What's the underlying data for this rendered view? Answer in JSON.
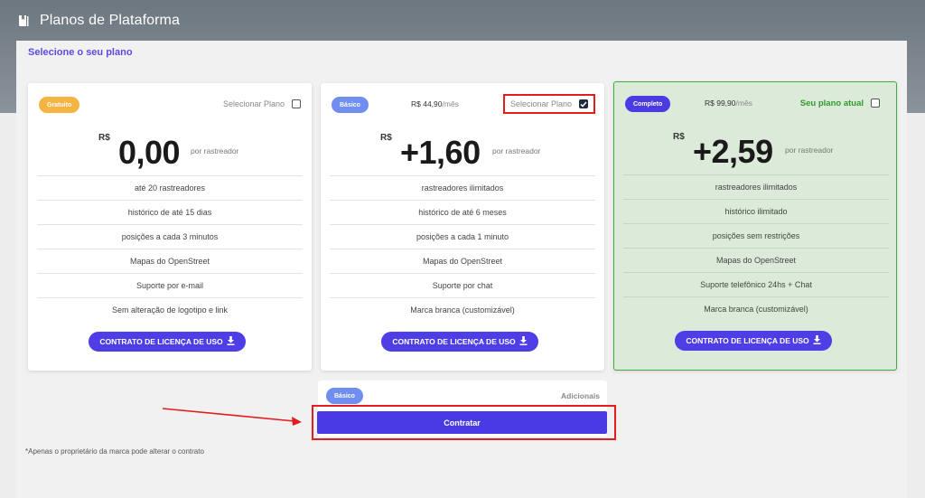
{
  "header": {
    "title": "Planos de Plataforma"
  },
  "panel": {
    "title": "Selecione o seu plano"
  },
  "plans": [
    {
      "badge": "Gratuito",
      "select_label": "Selecionar Plano",
      "currency": "R$",
      "price": "0,00",
      "per": "por rastreador",
      "features": [
        "até 20 rastreadores",
        "histórico de até 15 dias",
        "posições a cada 3 minutos",
        "Mapas do OpenStreet",
        "Suporte por e-mail",
        "Sem alteração de logotipo e link"
      ],
      "license_button": "CONTRATO DE LICENÇA DE USO",
      "checked": false
    },
    {
      "badge": "Básico",
      "monthly_price": "R$ 44,90",
      "monthly_unit": "/mês",
      "select_label": "Selecionar Plano",
      "currency": "R$",
      "price": "+1,60",
      "per": "por rastreador",
      "features": [
        "rastreadores ilimitados",
        "histórico de até 6 meses",
        "posições a cada 1 minuto",
        "Mapas do OpenStreet",
        "Suporte por chat",
        "Marca branca (customizável)"
      ],
      "license_button": "CONTRATO DE LICENÇA DE USO",
      "checked": true
    },
    {
      "badge": "Completo",
      "monthly_price": "R$ 99,90",
      "monthly_unit": "/mês",
      "select_label": "Seu plano atual",
      "currency": "R$",
      "price": "+2,59",
      "per": "por rastreador",
      "features": [
        "rastreadores ilimitados",
        "histórico ilimitado",
        "posições sem restrições",
        "Mapas do OpenStreet",
        "Suporte telefônico 24hs + Chat",
        "Marca branca (customizável)"
      ],
      "license_button": "CONTRATO DE LICENÇA DE USO",
      "checked": false
    }
  ],
  "summary": {
    "badge": "Básico",
    "extras_label": "Adicionais",
    "submit": "Contratar"
  },
  "footnote": "*Apenas o proprietário da marca pode alterar o contrato",
  "colors": {
    "accent": "#4f3de5",
    "current_plan": "#3fae3a",
    "highlight": "#e11d1d",
    "free_badge": "#f5b342",
    "basic_badge": "#6f8ef0"
  },
  "icons": {
    "header": "book-icon",
    "license": "download-icon",
    "checked": "check-icon"
  }
}
